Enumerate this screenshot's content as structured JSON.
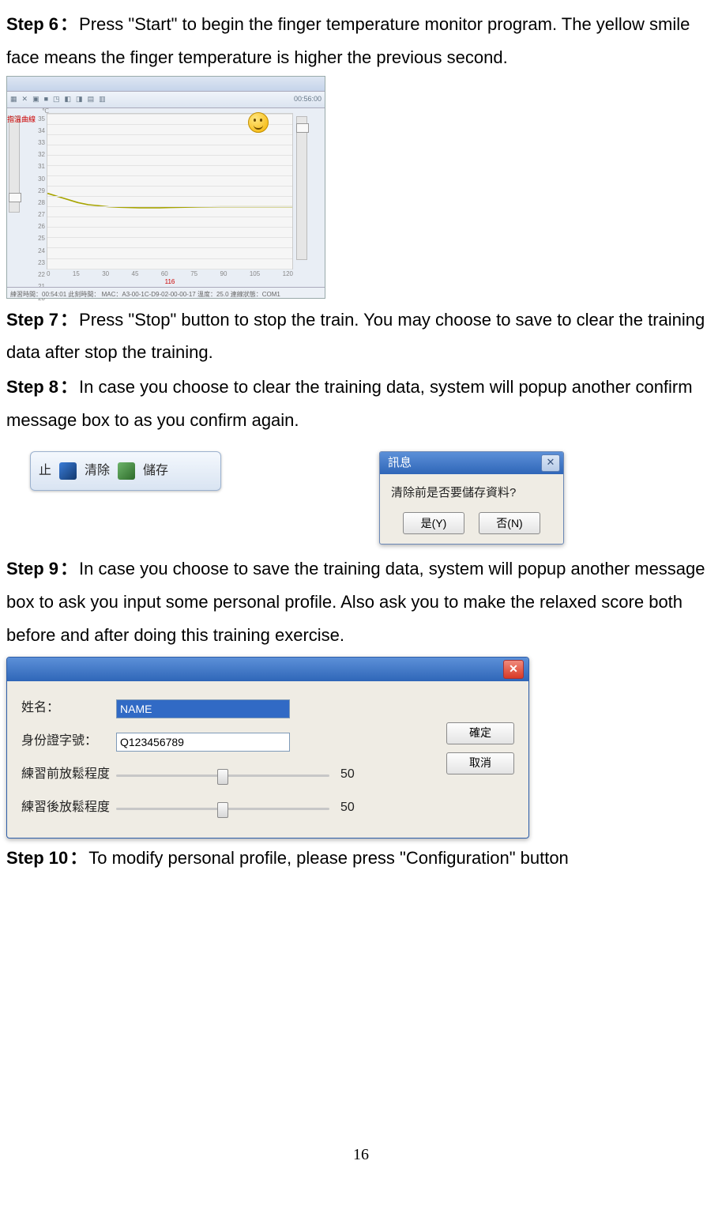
{
  "page_number": "16",
  "steps": {
    "s6": {
      "label": "Step 6",
      "sep": "：",
      "text": "Press \"Start\" to begin the finger temperature monitor program. The yellow smile face means the finger temperature is higher the previous second."
    },
    "s7": {
      "label": "Step 7",
      "sep": "：",
      "text": "Press \"Stop\" button to stop the train. You may choose to save to clear the training data after stop the training."
    },
    "s8": {
      "label": "Step 8",
      "sep": "：",
      "text": "In case you choose to clear the training data, system will popup another confirm message box to as you confirm again."
    },
    "s9": {
      "label": "Step 9",
      "sep": "：",
      "text": "In case you choose to save the training data, system will popup another message box to ask you input some personal profile. Also ask you to make the relaxed score both before and after doing this training exercise."
    },
    "s10": {
      "label": "Step 10",
      "sep": "：",
      "text": "To modify personal profile, please press \"Configuration\" button"
    }
  },
  "chart_data": {
    "type": "line",
    "title": "指溫曲線",
    "unit": "℃",
    "x": [
      0,
      5,
      10,
      15,
      20,
      25,
      30,
      35,
      40,
      45,
      50,
      55,
      60,
      65,
      70,
      75,
      80,
      85,
      90,
      95,
      100,
      105,
      110,
      115,
      120
    ],
    "y": [
      27.3,
      27.0,
      26.7,
      26.4,
      26.2,
      26.1,
      26.0,
      25.95,
      25.92,
      25.9,
      25.9,
      25.9,
      25.92,
      25.94,
      25.96,
      25.98,
      25.99,
      26.0,
      26.0,
      26.0,
      26.0,
      26.0,
      26.0,
      26.0,
      26.0
    ],
    "ylim": [
      20,
      35
    ],
    "xlim": [
      0,
      120
    ],
    "yticks": [
      20,
      21,
      22,
      23,
      24,
      25,
      26,
      27,
      28,
      29,
      30,
      31,
      32,
      33,
      34,
      35
    ],
    "xticks": [
      0,
      15,
      30,
      45,
      60,
      75,
      90,
      105,
      120
    ],
    "xcount_label": "116",
    "series_name": "temperature",
    "line_color": "#a7a400"
  },
  "chart_statusbar": "練習時間：00:54:01  此刻時間：  MAC：A3-00-1C-D9-02-00-00-17  溫度：25.0  連線狀態：COM1",
  "chart_toolbar_time": "00:56:00",
  "toolbar_snippet": {
    "stop_char": "止",
    "clear": "清除",
    "save": "儲存"
  },
  "msgbox": {
    "title": "訊息",
    "body": "清除前是否要儲存資料?",
    "yes": "是(Y)",
    "no": "否(N)"
  },
  "profile": {
    "name_label": "姓名：",
    "name_value": "NAME",
    "id_label": "身份證字號：",
    "id_value": "Q123456789",
    "pre_label": "練習前放鬆程度",
    "pre_value": "50",
    "post_label": "練習後放鬆程度",
    "post_value": "50",
    "ok": "確定",
    "cancel": "取消"
  }
}
